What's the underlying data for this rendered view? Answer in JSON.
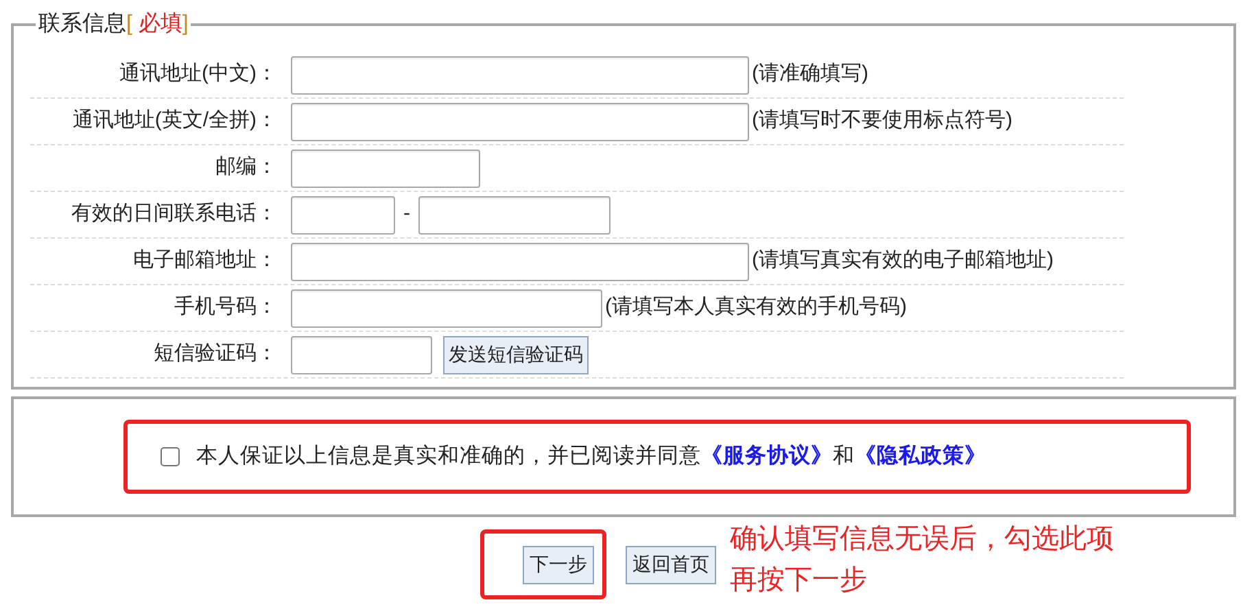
{
  "legend": {
    "title": "联系信息",
    "open": "[ ",
    "required": "必填",
    "close": "]"
  },
  "fields": [
    {
      "kind": "wide",
      "label": "通讯地址(中文)：",
      "hint": "(请准确填写)"
    },
    {
      "kind": "wide",
      "label": "通讯地址(英文/全拼)：",
      "hint": "(请填写时不要使用标点符号)"
    },
    {
      "kind": "narrow",
      "label": "邮编："
    },
    {
      "kind": "phone",
      "label": "有效的日间联系电话：",
      "separator": "-"
    },
    {
      "kind": "wide",
      "label": "电子邮箱地址：",
      "hint": "(请填写真实有效的电子邮箱地址)"
    },
    {
      "kind": "mobile",
      "label": "手机号码：",
      "hint": "(请填写本人真实有效的手机号码)"
    },
    {
      "kind": "sms",
      "label": "短信验证码：",
      "button": "发送短信验证码"
    }
  ],
  "consent": {
    "checked": false,
    "text": "本人保证以上信息是真实和准确的，并已阅读并同意",
    "link_1": "《服务协议》",
    "joiner": "和",
    "link_2": "《隐私政策》"
  },
  "buttons": [
    {
      "kind": "next",
      "label": "下一步"
    },
    {
      "kind": "home",
      "label": "返回首页"
    }
  ],
  "annotation": [
    "确认填写信息无误后，勾选此项",
    "再按下一步"
  ]
}
